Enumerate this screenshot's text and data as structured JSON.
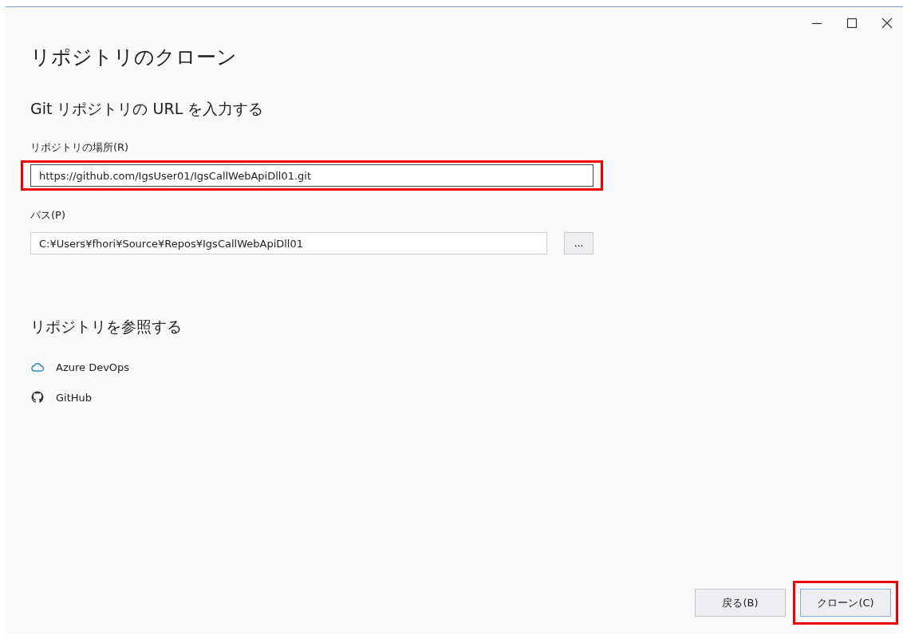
{
  "window": {
    "title": "リポジトリのクローン"
  },
  "section": {
    "heading": "Git リポジトリの URL を入力する"
  },
  "repository_location": {
    "label": "リポジトリの場所(R)",
    "value": "https://github.com/IgsUser01/IgsCallWebApiDll01.git",
    "highlighted": true
  },
  "path": {
    "label": "パス(P)",
    "value": "C:¥Users¥fhori¥Source¥Repos¥IgsCallWebApiDll01",
    "browse_button": "...",
    "highlighted": false
  },
  "browse": {
    "heading": "リポジトリを参照する",
    "items": [
      {
        "kind": "cloud",
        "label": "Azure DevOps"
      },
      {
        "kind": "github",
        "label": "GitHub"
      }
    ]
  },
  "buttons": [
    {
      "label": "戻る(B)",
      "primary": false,
      "highlighted": false
    },
    {
      "label": "クローン(C)",
      "primary": true,
      "highlighted": true
    }
  ]
}
